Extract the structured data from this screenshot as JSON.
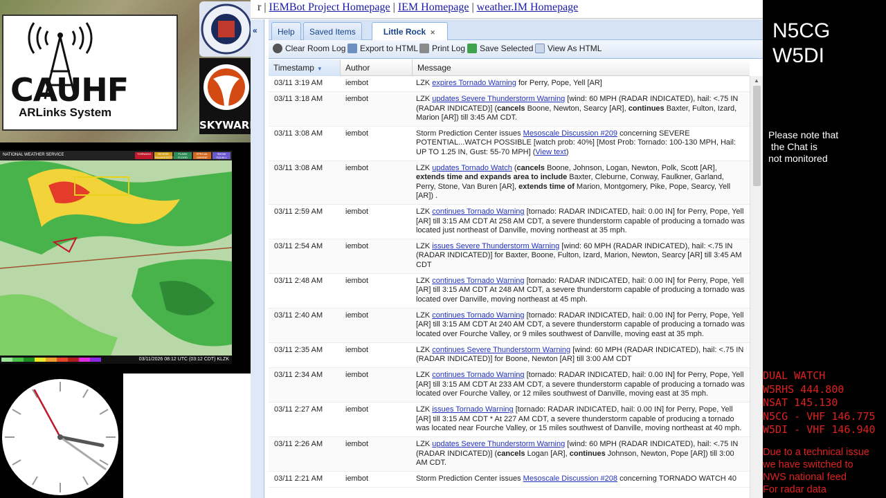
{
  "left": {
    "cauhf_title": "CAUHF",
    "cauhf_subtitle": "ARLinks System",
    "skywarn": "SKYWARN",
    "radar": {
      "header": "NATIONAL WEATHER SERVICE",
      "legend": [
        "TORNADO",
        "SEVERE THUNDERSTORM",
        "FLASH FLOOD",
        "SPECIAL MARINE",
        "SNOW SQUALL"
      ],
      "timestamp": "03/11/2026 08:12 UTC (03:12 CDT)",
      "station": "KLZK"
    }
  },
  "right": {
    "callsign1": "N5CG",
    "callsign2": "W5DI",
    "notice": "Please note that\n the Chat is\nnot monitored",
    "dual_watch": "DUAL WATCH\nW5RHS 444.800\nNSAT 145.130\nN5CG - VHF 146.775\nW5DI - VHF 146.940",
    "tech_note": "Due to a technical issue\nwe have switched to\nNWS national feed\nFor radar data"
  },
  "app": {
    "topbar": {
      "prefix": "r",
      "links": [
        "IEMBot Project Homepage",
        "IEM Homepage",
        "weather.IM Homepage"
      ],
      "separator": "|"
    },
    "collapse_label": "«",
    "tabs": [
      {
        "label": "Help"
      },
      {
        "label": "Saved Items"
      },
      {
        "label": "Little Rock",
        "close": "✕"
      }
    ],
    "toolbar": {
      "clear": "Clear Room Log",
      "export": "Export to HTML",
      "print": "Print Log",
      "save": "Save Selected",
      "view": "View As HTML"
    },
    "columns": {
      "timestamp": "Timestamp",
      "author": "Author",
      "message": "Message"
    },
    "sort_indicator": "▼",
    "rows": [
      {
        "ts": "03/11 3:19 AM",
        "author": "iembot",
        "parts": [
          [
            "t",
            "LZK "
          ],
          [
            "l",
            "expires Tornado Warning"
          ],
          [
            "t",
            " for Perry, Pope, Yell [AR]"
          ]
        ]
      },
      {
        "ts": "03/11 3:18 AM",
        "author": "iembot",
        "parts": [
          [
            "t",
            "LZK "
          ],
          [
            "l",
            "updates Severe Thunderstorm Warning"
          ],
          [
            "t",
            " [wind: 60 MPH (RADAR INDICATED), hail: <.75 IN (RADAR INDICATED)] ("
          ],
          [
            "b",
            "cancels"
          ],
          [
            "t",
            " Boone, Newton, Searcy [AR], "
          ],
          [
            "b",
            "continues"
          ],
          [
            "t",
            " Baxter, Fulton, Izard, Marion [AR]) till 3:45 AM CDT."
          ]
        ]
      },
      {
        "ts": "03/11 3:08 AM",
        "author": "iembot",
        "parts": [
          [
            "t",
            "Storm Prediction Center issues "
          ],
          [
            "l",
            "Mesoscale Discussion #209"
          ],
          [
            "t",
            " concerning SEVERE POTENTIAL...WATCH POSSIBLE [watch prob: 40%] [Most Prob: Tornado: 100-130 MPH, Hail: UP TO 1.25 IN, Gust: 55-70 MPH] ("
          ],
          [
            "l",
            "View text"
          ],
          [
            "t",
            ")"
          ]
        ]
      },
      {
        "ts": "03/11 3:08 AM",
        "author": "iembot",
        "parts": [
          [
            "t",
            "LZK "
          ],
          [
            "l",
            "updates Tornado Watch"
          ],
          [
            "t",
            " ("
          ],
          [
            "b",
            "cancels"
          ],
          [
            "t",
            " Boone, Johnson, Logan, Newton, Polk, Scott [AR], "
          ],
          [
            "b",
            "extends time and expands area to include"
          ],
          [
            "t",
            " Baxter, Cleburne, Conway, Faulkner, Garland, Perry, Stone, Van Buren [AR], "
          ],
          [
            "b",
            "extends time of"
          ],
          [
            "t",
            " Marion, Montgomery, Pike, Pope, Searcy, Yell [AR]) ."
          ]
        ]
      },
      {
        "ts": "03/11 2:59 AM",
        "author": "iembot",
        "parts": [
          [
            "t",
            "LZK "
          ],
          [
            "l",
            "continues Tornado Warning"
          ],
          [
            "t",
            " [tornado: RADAR INDICATED, hail: 0.00 IN] for Perry, Pope, Yell [AR] till 3:15 AM CDT At 258 AM CDT, a severe thunderstorm capable of producing a tornado was located just northeast of Danville, moving northeast at 35 mph."
          ]
        ]
      },
      {
        "ts": "03/11 2:54 AM",
        "author": "iembot",
        "parts": [
          [
            "t",
            "LZK "
          ],
          [
            "l",
            "issues Severe Thunderstorm Warning"
          ],
          [
            "t",
            " [wind: 60 MPH (RADAR INDICATED), hail: <.75 IN (RADAR INDICATED)] for Baxter, Boone, Fulton, Izard, Marion, Newton, Searcy [AR] till 3:45 AM CDT"
          ]
        ]
      },
      {
        "ts": "03/11 2:48 AM",
        "author": "iembot",
        "parts": [
          [
            "t",
            "LZK "
          ],
          [
            "l",
            "continues Tornado Warning"
          ],
          [
            "t",
            " [tornado: RADAR INDICATED, hail: 0.00 IN] for Perry, Pope, Yell [AR] till 3:15 AM CDT At 248 AM CDT, a severe thunderstorm capable of producing a tornado was located over Danville, moving northeast at 45 mph."
          ]
        ]
      },
      {
        "ts": "03/11 2:40 AM",
        "author": "iembot",
        "parts": [
          [
            "t",
            "LZK "
          ],
          [
            "l",
            "continues Tornado Warning"
          ],
          [
            "t",
            " [tornado: RADAR INDICATED, hail: 0.00 IN] for Perry, Pope, Yell [AR] till 3:15 AM CDT At 240 AM CDT, a severe thunderstorm capable of producing a tornado was located over Fourche Valley, or 9 miles southwest of Danville, moving east at 35 mph."
          ]
        ]
      },
      {
        "ts": "03/11 2:35 AM",
        "author": "iembot",
        "parts": [
          [
            "t",
            "LZK "
          ],
          [
            "l",
            "continues Severe Thunderstorm Warning"
          ],
          [
            "t",
            " [wind: 60 MPH (RADAR INDICATED), hail: <.75 IN (RADAR INDICATED)] for Boone, Newton [AR] till 3:00 AM CDT"
          ]
        ]
      },
      {
        "ts": "03/11 2:34 AM",
        "author": "iembot",
        "parts": [
          [
            "t",
            "LZK "
          ],
          [
            "l",
            "continues Tornado Warning"
          ],
          [
            "t",
            " [tornado: RADAR INDICATED, hail: 0.00 IN] for Perry, Pope, Yell [AR] till 3:15 AM CDT At 233 AM CDT, a severe thunderstorm capable of producing a tornado was located over Fourche Valley, or 12 miles southwest of Danville, moving east at 35 mph."
          ]
        ]
      },
      {
        "ts": "03/11 2:27 AM",
        "author": "iembot",
        "parts": [
          [
            "t",
            "LZK "
          ],
          [
            "l",
            "issues Tornado Warning"
          ],
          [
            "t",
            " [tornado: RADAR INDICATED, hail: 0.00 IN] for Perry, Pope, Yell [AR] till 3:15 AM CDT * At 227 AM CDT, a severe thunderstorm capable of producing a tornado was located near Fourche Valley, or 15 miles southwest of Danville, moving northeast at 40 mph."
          ]
        ]
      },
      {
        "ts": "03/11 2:26 AM",
        "author": "iembot",
        "parts": [
          [
            "t",
            "LZK "
          ],
          [
            "l",
            "updates Severe Thunderstorm Warning"
          ],
          [
            "t",
            " [wind: 60 MPH (RADAR INDICATED), hail: <.75 IN (RADAR INDICATED)] ("
          ],
          [
            "b",
            "cancels"
          ],
          [
            "t",
            " Logan [AR], "
          ],
          [
            "b",
            "continues"
          ],
          [
            "t",
            " Johnson, Newton, Pope [AR]) till 3:00 AM CDT."
          ]
        ]
      },
      {
        "ts": "03/11 2:21 AM",
        "author": "iembot",
        "parts": [
          [
            "t",
            "Storm Prediction Center issues "
          ],
          [
            "l",
            "Mesoscale Discussion #208"
          ],
          [
            "t",
            " concerning TORNADO WATCH 40"
          ]
        ]
      }
    ]
  },
  "clock": {
    "time": "03:12"
  },
  "colors": {
    "accent": "#15428b",
    "link": "#2233bb",
    "alert_red": "#e02020"
  }
}
